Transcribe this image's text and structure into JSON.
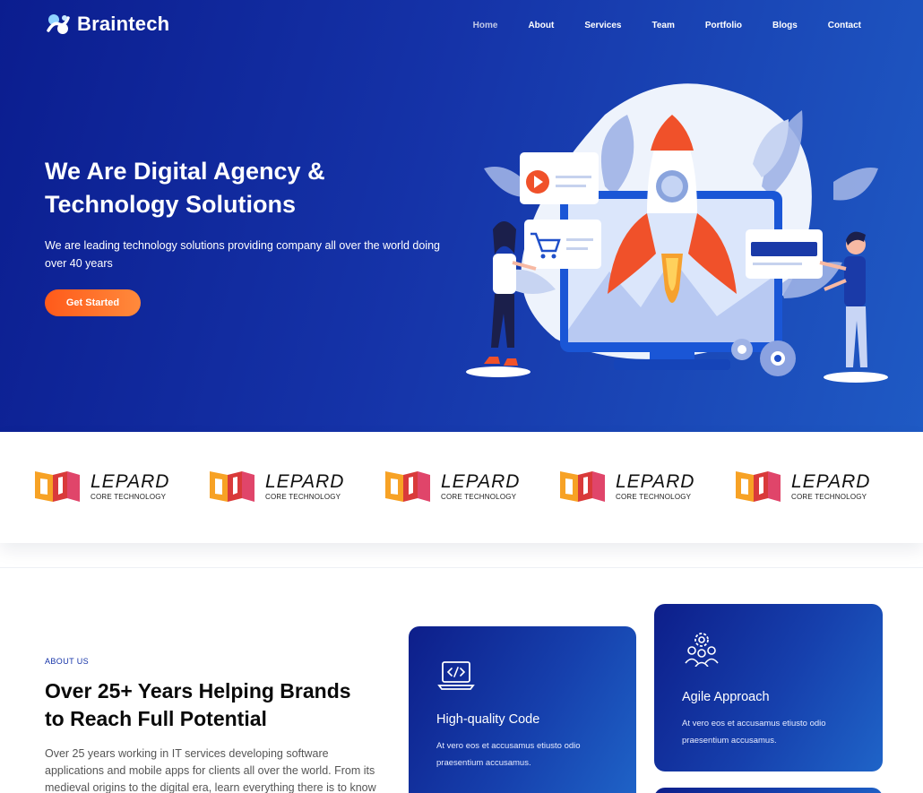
{
  "header": {
    "brand": "Braintech",
    "nav": [
      "Home",
      "About",
      "Services",
      "Team",
      "Portfolio",
      "Blogs",
      "Contact"
    ],
    "active_nav": "Home"
  },
  "hero": {
    "title_line1": "We Are Digital Agency &",
    "title_line2": "Technology Solutions",
    "subtitle": "We are leading technology solutions providing company all over the world doing over 40 years",
    "cta_label": "Get Started",
    "illustration_icon": "rocket-launch-illustration"
  },
  "partners": [
    {
      "name": "LEPARD",
      "tag": "CORE TECHNOLOGY"
    },
    {
      "name": "LEPARD",
      "tag": "CORE TECHNOLOGY"
    },
    {
      "name": "LEPARD",
      "tag": "CORE TECHNOLOGY"
    },
    {
      "name": "LEPARD",
      "tag": "CORE TECHNOLOGY"
    },
    {
      "name": "LEPARD",
      "tag": "CORE TECHNOLOGY"
    }
  ],
  "about": {
    "kicker": "ABOUT US",
    "title_line1": "Over 25+ Years Helping Brands",
    "title_line2": "to Reach Full Potential",
    "text": "Over 25 years working in IT services developing software applications and mobile apps for clients all over the world. From its medieval origins to the digital era, learn everything there is to know"
  },
  "cards": [
    {
      "icon": "code-laptop-icon",
      "title": "High-quality Code",
      "text": "At vero eos et accusamus etiusto odio praesentium accusamus."
    },
    {
      "icon": "team-gear-icon",
      "title": "Agile Approach",
      "text": "At vero eos et accusamus etiusto odio praesentium accusamus."
    }
  ],
  "colors": {
    "hero_start": "#0b1d8f",
    "hero_end": "#1f5ac4",
    "cta_start": "#ff5a1a",
    "cta_end": "#ff8a3c",
    "accent": "#1533a8"
  }
}
